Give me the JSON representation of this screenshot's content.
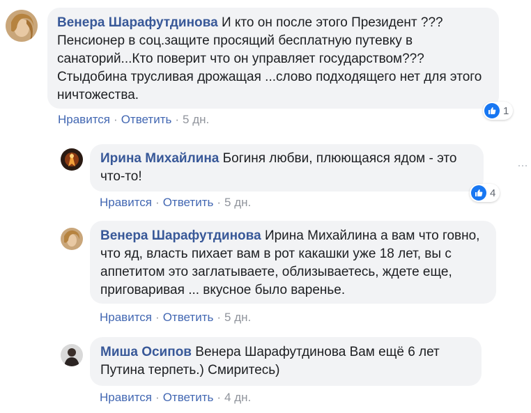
{
  "comments": [
    {
      "author": "Венера Шарафутдинова",
      "text": "И кто он после этого Президент ??? Пенсионер в соц.защите просящий бесплатную путевку в санаторий...Кто поверит что он управляет государством??? Стыдобина трусливая дрожащая ...слово подходящего нет для этого ничтожества.",
      "like_label": "Нравится",
      "reply_label": "Ответить",
      "time": "5 дн.",
      "reactions": "1"
    }
  ],
  "replies": [
    {
      "author": "Ирина Михайлина",
      "text": "Богиня любви, плюющаяся ядом - это что-то!",
      "like_label": "Нравится",
      "reply_label": "Ответить",
      "time": "5 дн.",
      "reactions": "4"
    },
    {
      "author": "Венера Шарафутдинова",
      "text": "Ирина Михайлина а вам что говно, что яд, власть пихает вам в рот какашки уже 18 лет, вы с аппетитом это заглатываете, облизываетесь, ждете еще, приговаривая ... вкусное было варенье.",
      "like_label": "Нравится",
      "reply_label": "Ответить",
      "time": "5 дн."
    },
    {
      "author": "Миша Осипов",
      "text": "Венера Шарафутдинова Вам ещё 6 лет Путина терпеть.) Смиритесь)",
      "like_label": "Нравится",
      "reply_label": "Ответить",
      "time": "4 дн."
    }
  ],
  "more_options_glyph": "···",
  "colors": {
    "author": "#385898",
    "bubble": "#f2f3f5",
    "action_link": "#4267b2",
    "meta": "#90949c",
    "like": "#1877f2"
  }
}
